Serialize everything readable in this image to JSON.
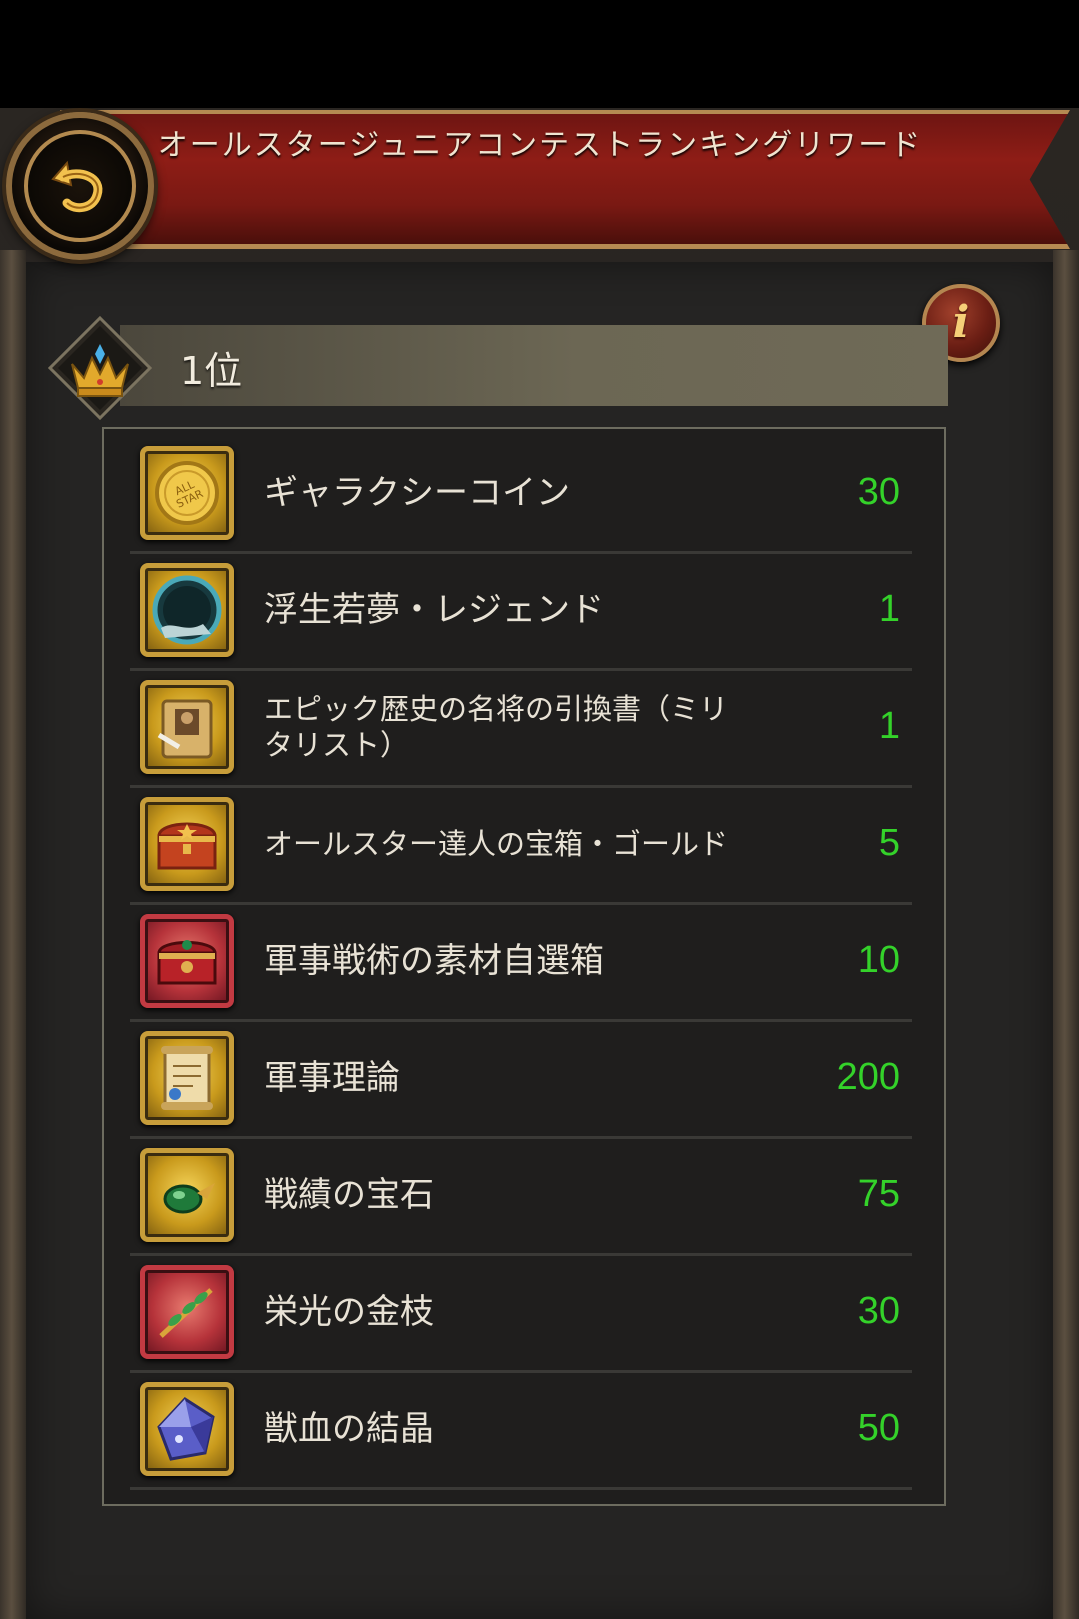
{
  "header": {
    "title": "オールスタージュニアコンテストランキングリワード",
    "back_icon": "back-arrow-icon",
    "info_icon": "info-icon",
    "info_symbol": "i"
  },
  "rank": {
    "label": "1位",
    "icon": "crown-icon"
  },
  "colors": {
    "quantity": "#34d22a",
    "banner": "#8e1d16",
    "border_gold": "#c79d3a",
    "border_red": "#c23a42"
  },
  "rewards": [
    {
      "name": "ギャラクシーコイン",
      "qty": "30",
      "icon": "all-star-coin-icon",
      "frame": "gold"
    },
    {
      "name": "浮生若夢・レジェンド",
      "qty": "1",
      "icon": "mirror-frame-icon",
      "frame": "gold"
    },
    {
      "name": "エピック歴史の名将の引換書（ミリタリスト）",
      "qty": "1",
      "icon": "scroll-portrait-icon",
      "frame": "gold"
    },
    {
      "name": "オールスター達人の宝箱・ゴールド",
      "qty": "5",
      "icon": "treasure-chest-icon",
      "frame": "gold"
    },
    {
      "name": "軍事戦術の素材自選箱",
      "qty": "10",
      "icon": "red-chest-icon",
      "frame": "red"
    },
    {
      "name": "軍事理論",
      "qty": "200",
      "icon": "scroll-icon",
      "frame": "gold"
    },
    {
      "name": "戦績の宝石",
      "qty": "75",
      "icon": "green-gem-icon",
      "frame": "gold"
    },
    {
      "name": "栄光の金枝",
      "qty": "30",
      "icon": "golden-branch-icon",
      "frame": "red"
    },
    {
      "name": "獣血の結晶",
      "qty": "50",
      "icon": "crystal-icon",
      "frame": "gold"
    }
  ]
}
